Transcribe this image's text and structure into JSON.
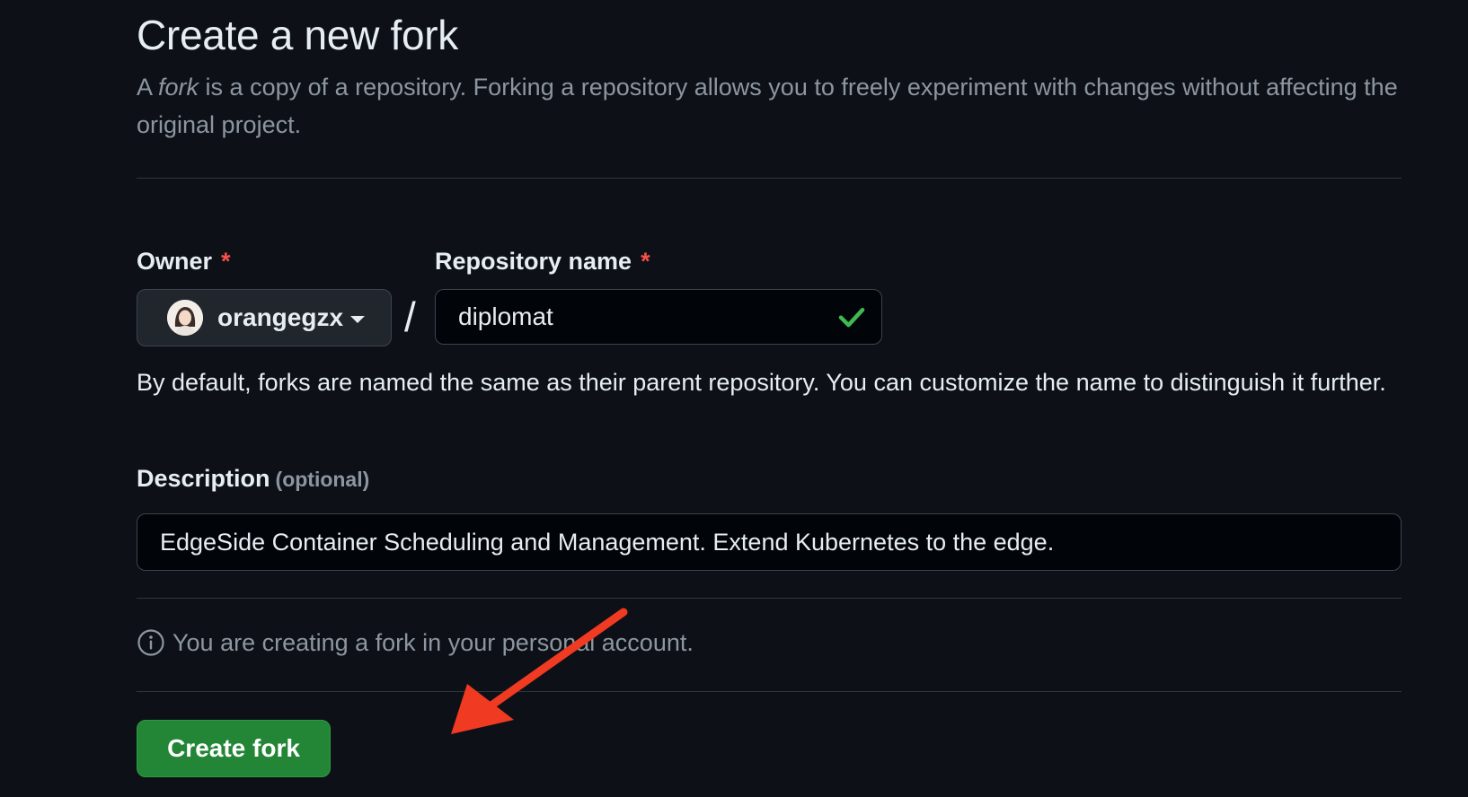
{
  "header": {
    "title": "Create a new fork",
    "lead_prefix": "A ",
    "lead_emphasis": "fork",
    "lead_suffix": " is a copy of a repository. Forking a repository allows you to freely experiment with changes without affecting the original project."
  },
  "owner": {
    "label": "Owner",
    "required_mark": "*",
    "selected": "orangegzx"
  },
  "repository": {
    "label": "Repository name",
    "required_mark": "*",
    "value": "diplomat",
    "valid": true,
    "slash": "/"
  },
  "hint": "By default, forks are named the same as their parent repository. You can customize the name to distinguish it further.",
  "description": {
    "label": "Description",
    "optional_label": "(optional)",
    "value": "EdgeSide Container Scheduling and Management. Extend Kubernetes to the edge."
  },
  "notice": "You are creating a fork in your personal account.",
  "actions": {
    "create_label": "Create fork"
  },
  "colors": {
    "background": "#0d1117",
    "primary_button": "#238636",
    "required": "#f85149",
    "valid_check": "#3fb950",
    "annotation_arrow": "#f03a22"
  }
}
